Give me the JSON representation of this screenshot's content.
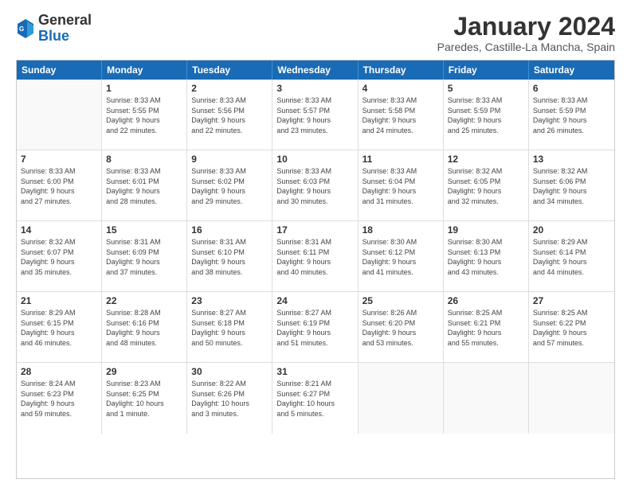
{
  "logo": {
    "general": "General",
    "blue": "Blue"
  },
  "title": "January 2024",
  "subtitle": "Paredes, Castille-La Mancha, Spain",
  "headers": [
    "Sunday",
    "Monday",
    "Tuesday",
    "Wednesday",
    "Thursday",
    "Friday",
    "Saturday"
  ],
  "weeks": [
    [
      {
        "day": "",
        "info": ""
      },
      {
        "day": "1",
        "info": "Sunrise: 8:33 AM\nSunset: 5:55 PM\nDaylight: 9 hours\nand 22 minutes."
      },
      {
        "day": "2",
        "info": "Sunrise: 8:33 AM\nSunset: 5:56 PM\nDaylight: 9 hours\nand 22 minutes."
      },
      {
        "day": "3",
        "info": "Sunrise: 8:33 AM\nSunset: 5:57 PM\nDaylight: 9 hours\nand 23 minutes."
      },
      {
        "day": "4",
        "info": "Sunrise: 8:33 AM\nSunset: 5:58 PM\nDaylight: 9 hours\nand 24 minutes."
      },
      {
        "day": "5",
        "info": "Sunrise: 8:33 AM\nSunset: 5:59 PM\nDaylight: 9 hours\nand 25 minutes."
      },
      {
        "day": "6",
        "info": "Sunrise: 8:33 AM\nSunset: 5:59 PM\nDaylight: 9 hours\nand 26 minutes."
      }
    ],
    [
      {
        "day": "7",
        "info": "Sunrise: 8:33 AM\nSunset: 6:00 PM\nDaylight: 9 hours\nand 27 minutes."
      },
      {
        "day": "8",
        "info": "Sunrise: 8:33 AM\nSunset: 6:01 PM\nDaylight: 9 hours\nand 28 minutes."
      },
      {
        "day": "9",
        "info": "Sunrise: 8:33 AM\nSunset: 6:02 PM\nDaylight: 9 hours\nand 29 minutes."
      },
      {
        "day": "10",
        "info": "Sunrise: 8:33 AM\nSunset: 6:03 PM\nDaylight: 9 hours\nand 30 minutes."
      },
      {
        "day": "11",
        "info": "Sunrise: 8:33 AM\nSunset: 6:04 PM\nDaylight: 9 hours\nand 31 minutes."
      },
      {
        "day": "12",
        "info": "Sunrise: 8:32 AM\nSunset: 6:05 PM\nDaylight: 9 hours\nand 32 minutes."
      },
      {
        "day": "13",
        "info": "Sunrise: 8:32 AM\nSunset: 6:06 PM\nDaylight: 9 hours\nand 34 minutes."
      }
    ],
    [
      {
        "day": "14",
        "info": "Sunrise: 8:32 AM\nSunset: 6:07 PM\nDaylight: 9 hours\nand 35 minutes."
      },
      {
        "day": "15",
        "info": "Sunrise: 8:31 AM\nSunset: 6:09 PM\nDaylight: 9 hours\nand 37 minutes."
      },
      {
        "day": "16",
        "info": "Sunrise: 8:31 AM\nSunset: 6:10 PM\nDaylight: 9 hours\nand 38 minutes."
      },
      {
        "day": "17",
        "info": "Sunrise: 8:31 AM\nSunset: 6:11 PM\nDaylight: 9 hours\nand 40 minutes."
      },
      {
        "day": "18",
        "info": "Sunrise: 8:30 AM\nSunset: 6:12 PM\nDaylight: 9 hours\nand 41 minutes."
      },
      {
        "day": "19",
        "info": "Sunrise: 8:30 AM\nSunset: 6:13 PM\nDaylight: 9 hours\nand 43 minutes."
      },
      {
        "day": "20",
        "info": "Sunrise: 8:29 AM\nSunset: 6:14 PM\nDaylight: 9 hours\nand 44 minutes."
      }
    ],
    [
      {
        "day": "21",
        "info": "Sunrise: 8:29 AM\nSunset: 6:15 PM\nDaylight: 9 hours\nand 46 minutes."
      },
      {
        "day": "22",
        "info": "Sunrise: 8:28 AM\nSunset: 6:16 PM\nDaylight: 9 hours\nand 48 minutes."
      },
      {
        "day": "23",
        "info": "Sunrise: 8:27 AM\nSunset: 6:18 PM\nDaylight: 9 hours\nand 50 minutes."
      },
      {
        "day": "24",
        "info": "Sunrise: 8:27 AM\nSunset: 6:19 PM\nDaylight: 9 hours\nand 51 minutes."
      },
      {
        "day": "25",
        "info": "Sunrise: 8:26 AM\nSunset: 6:20 PM\nDaylight: 9 hours\nand 53 minutes."
      },
      {
        "day": "26",
        "info": "Sunrise: 8:25 AM\nSunset: 6:21 PM\nDaylight: 9 hours\nand 55 minutes."
      },
      {
        "day": "27",
        "info": "Sunrise: 8:25 AM\nSunset: 6:22 PM\nDaylight: 9 hours\nand 57 minutes."
      }
    ],
    [
      {
        "day": "28",
        "info": "Sunrise: 8:24 AM\nSunset: 6:23 PM\nDaylight: 9 hours\nand 59 minutes."
      },
      {
        "day": "29",
        "info": "Sunrise: 8:23 AM\nSunset: 6:25 PM\nDaylight: 10 hours\nand 1 minute."
      },
      {
        "day": "30",
        "info": "Sunrise: 8:22 AM\nSunset: 6:26 PM\nDaylight: 10 hours\nand 3 minutes."
      },
      {
        "day": "31",
        "info": "Sunrise: 8:21 AM\nSunset: 6:27 PM\nDaylight: 10 hours\nand 5 minutes."
      },
      {
        "day": "",
        "info": ""
      },
      {
        "day": "",
        "info": ""
      },
      {
        "day": "",
        "info": ""
      }
    ]
  ]
}
